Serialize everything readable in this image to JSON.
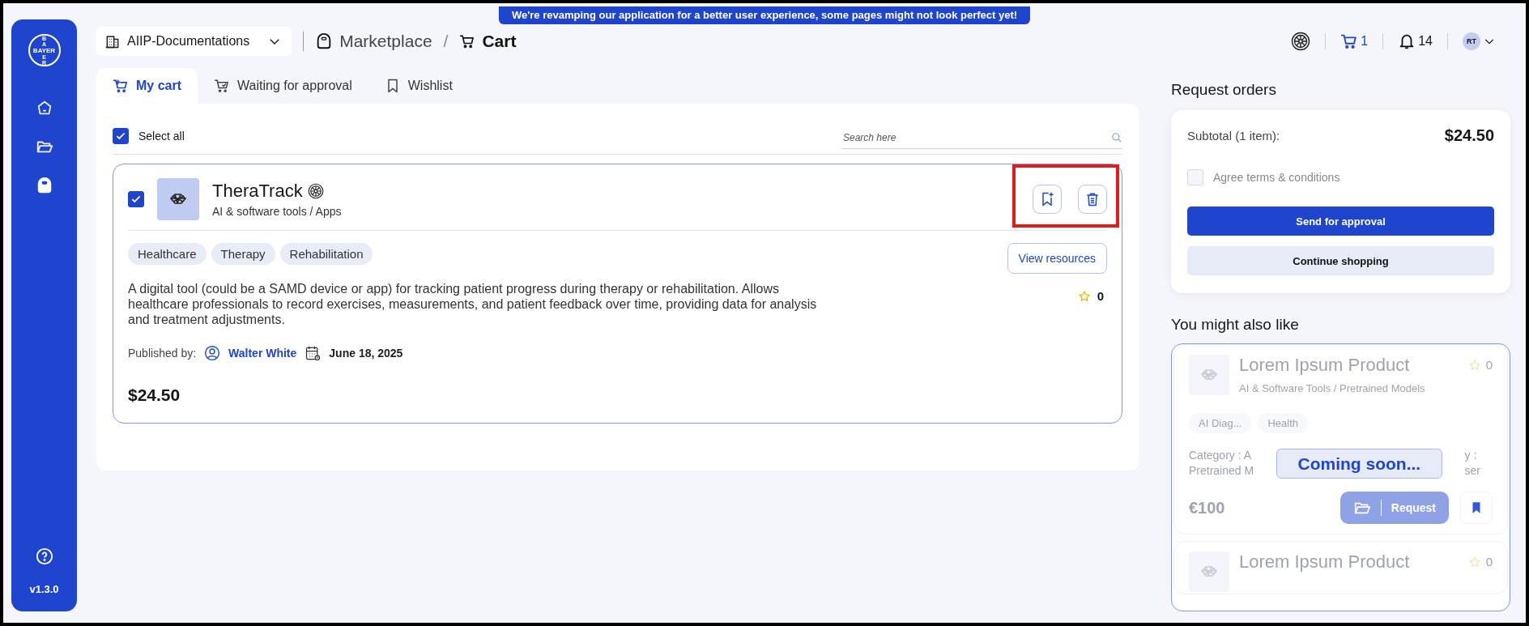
{
  "banner": "We're revamping our application for a better user experience, some pages might not look perfect yet!",
  "sidebar": {
    "logo": {
      "vertical_top": "BA",
      "horizontal": "BAYER",
      "vertical_bottom": "ER"
    },
    "items": [
      {
        "kind": "home",
        "selected": false
      },
      {
        "kind": "folder",
        "selected": false
      },
      {
        "kind": "bag",
        "selected": true
      }
    ],
    "version": "v1.3.0"
  },
  "header": {
    "workspace": "AIIP-Documentations",
    "breadcrumb": [
      {
        "label": "Marketplace",
        "kind": "bag",
        "current": false
      },
      {
        "label": "Cart",
        "kind": "cart",
        "current": true
      }
    ],
    "breadcrumb_separator": "/",
    "cart_count": "1",
    "notification_count": "14",
    "avatar": "RT"
  },
  "tabs": [
    {
      "label": "My cart",
      "kind": "cart",
      "selected": true
    },
    {
      "label": "Waiting for approval",
      "kind": "pending",
      "selected": false
    },
    {
      "label": "Wishlist",
      "kind": "bookmark",
      "selected": false
    }
  ],
  "cart": {
    "select_all": {
      "label": "Select all",
      "checked": true
    },
    "search": {
      "placeholder": "Search here"
    },
    "items": [
      {
        "checked": true,
        "title": "TheraTrack",
        "category": "AI & software tools / Apps",
        "tags": [
          "Healthcare",
          "Therapy",
          "Rehabilitation"
        ],
        "description": "A digital tool (could be a SAMD device or app) for tracking patient progress during therapy or rehabilitation. Allows healthcare professionals to record exercises, measurements, and patient feedback over time, providing data for analysis and treatment adjustments.",
        "published_label": "Published by:",
        "publisher": "Walter White",
        "date": "June 18, 2025",
        "price": "$24.50",
        "rating": "0",
        "action": "View resources",
        "highlighted": true
      }
    ]
  },
  "summary": {
    "title": "Request orders",
    "subtotal_label": "Subtotal (1 item):",
    "subtotal": "$24.50",
    "terms": {
      "label": "Agree terms & conditions",
      "checked": false
    },
    "buttons": [
      {
        "label": "Send for approval",
        "kind": "primary"
      },
      {
        "label": "Continue shopping",
        "kind": "secondary"
      }
    ]
  },
  "suggestions": {
    "title": "You might also like",
    "overlay": "Coming soon...",
    "items": [
      {
        "title": "Lorem Ipsum Product",
        "rating": "0",
        "category": "AI & Software Tools / Pretrained Models",
        "tags": [
          "AI Diag...",
          "Health"
        ],
        "description_left": [
          "Category : A",
          "Pretrained M"
        ],
        "description_right": [
          "y :",
          "ser"
        ],
        "price": "€100",
        "action": "Request"
      },
      {
        "title": "Lorem Ipsum Product",
        "rating": "0"
      }
    ]
  }
}
